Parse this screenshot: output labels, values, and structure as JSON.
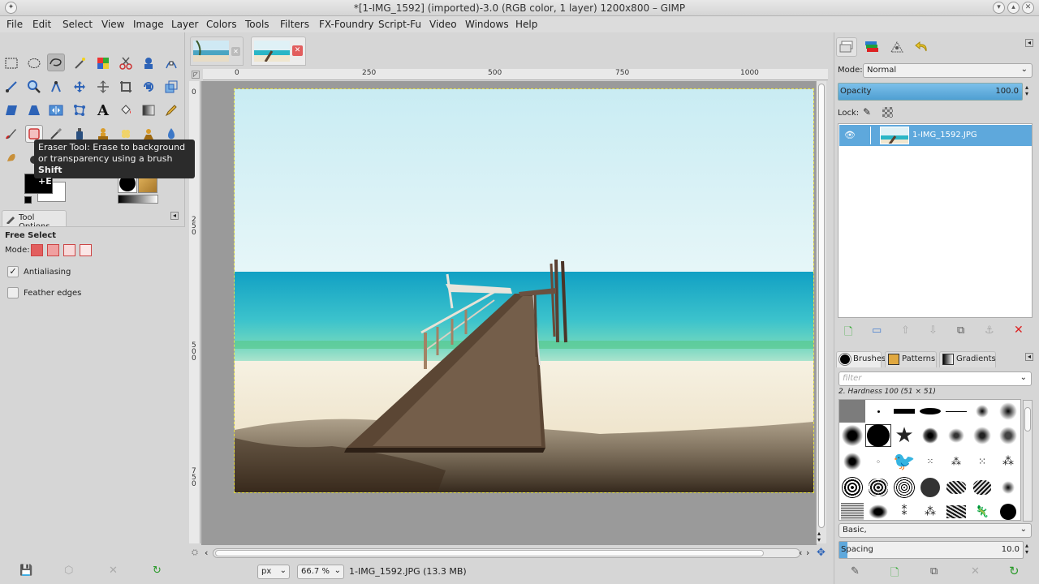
{
  "window": {
    "title": "*[1-IMG_1592] (imported)-3.0 (RGB color, 1 layer) 1200x800 – GIMP"
  },
  "menu": [
    "File",
    "Edit",
    "Select",
    "View",
    "Image",
    "Layer",
    "Colors",
    "Tools",
    "Filters",
    "FX-Foundry",
    "Script-Fu",
    "Video",
    "Windows",
    "Help"
  ],
  "tooltip": {
    "line1": "Eraser Tool: Erase to background",
    "line2": "or transparency using a brush",
    "shortcut_a": "Shift",
    "shortcut_b": "+E"
  },
  "tool_options": {
    "tab_label": "Tool Options",
    "title": "Free Select",
    "mode_label": "Mode:",
    "antialiasing": "Antialiasing",
    "feather": "Feather edges"
  },
  "rulers": {
    "top": [
      "0",
      "250",
      "500",
      "750",
      "1000"
    ],
    "left": [
      "0",
      "2\n5\n0",
      "5\n0\n0",
      "7\n5\n0"
    ]
  },
  "status": {
    "unit": "px",
    "zoom": "66.7 %",
    "info": "1-IMG_1592.JPG (13.3 MB)"
  },
  "layers": {
    "mode_label": "Mode:",
    "mode_value": "Normal",
    "opacity_label": "Opacity",
    "opacity_value": "100.0",
    "lock_label": "Lock:",
    "layer_name": "1-IMG_1592.JPG"
  },
  "brushes": {
    "tabs": [
      "Brushes",
      "Patterns",
      "Gradients"
    ],
    "filter_placeholder": "filter",
    "selected": "2. Hardness 100 (51 × 51)",
    "tag": "Basic,",
    "spacing_label": "Spacing",
    "spacing_value": "10.0"
  },
  "colors": {
    "selection_blue": "#5ea8dc",
    "accent_red": "#e25e5e"
  }
}
